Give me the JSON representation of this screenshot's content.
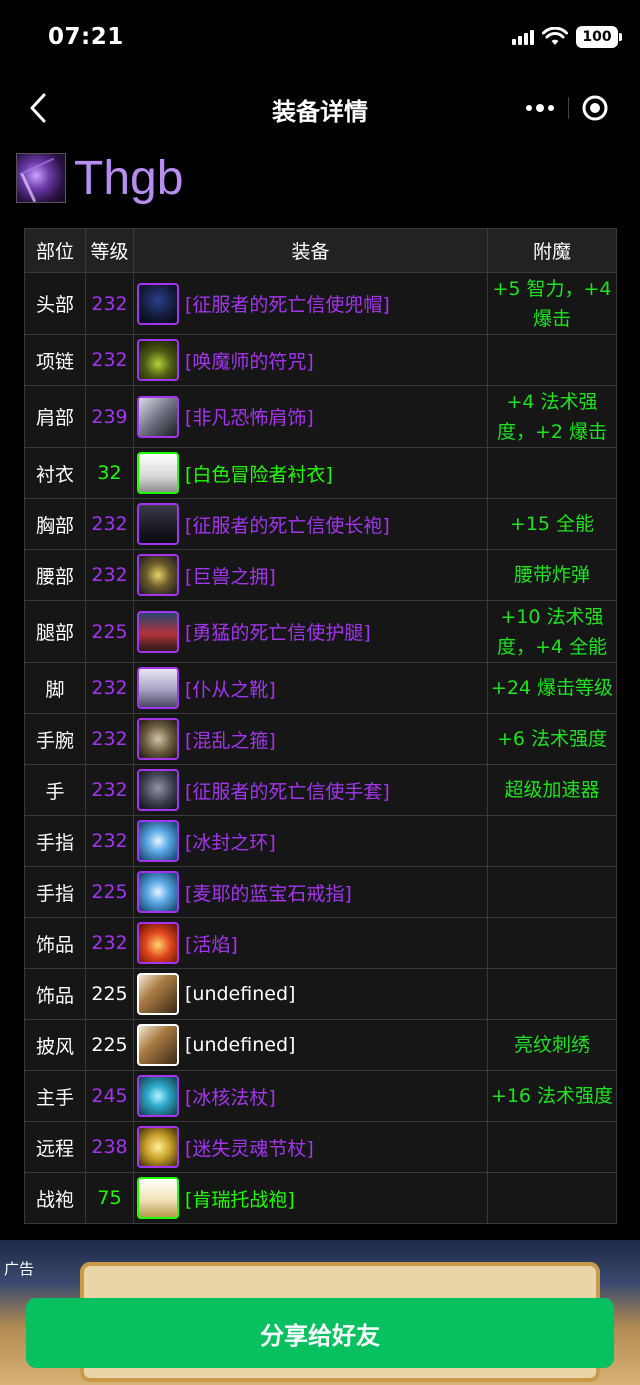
{
  "status": {
    "time": "07:21",
    "battery": "100"
  },
  "nav": {
    "title": "装备详情"
  },
  "character": {
    "name": "Thgb"
  },
  "table": {
    "headers": {
      "slot": "部位",
      "level": "等级",
      "item": "装备",
      "enchant": "附魔"
    },
    "rows": [
      {
        "slot": "头部",
        "level": "232",
        "item": "[征服者的死亡信使兜帽]",
        "enchant": "+5 智力，+4 爆击",
        "quality": "epic",
        "icon": "hood-icon"
      },
      {
        "slot": "项链",
        "level": "232",
        "item": "[唤魔师的符咒]",
        "enchant": "",
        "quality": "epic",
        "icon": "necklace-icon"
      },
      {
        "slot": "肩部",
        "level": "239",
        "item": "[非凡恐怖肩饰]",
        "enchant": "+4 法术强度，+2 爆击",
        "quality": "epic",
        "icon": "shoulder-icon"
      },
      {
        "slot": "衬衣",
        "level": "32",
        "item": "[白色冒险者衬衣]",
        "enchant": "",
        "quality": "uncommon",
        "icon": "shirt-icon"
      },
      {
        "slot": "胸部",
        "level": "232",
        "item": "[征服者的死亡信使长袍]",
        "enchant": "+15 全能",
        "quality": "epic",
        "icon": "robe-icon"
      },
      {
        "slot": "腰部",
        "level": "232",
        "item": "[巨兽之拥]",
        "enchant": "腰带炸弹",
        "quality": "epic",
        "icon": "belt-icon"
      },
      {
        "slot": "腿部",
        "level": "225",
        "item": "[勇猛的死亡信使护腿]",
        "enchant": "+10 法术强度，+4 全能",
        "quality": "epic",
        "icon": "legs-icon"
      },
      {
        "slot": "脚",
        "level": "232",
        "item": "[仆从之靴]",
        "enchant": "+24 爆击等级",
        "quality": "epic",
        "icon": "boots-icon"
      },
      {
        "slot": "手腕",
        "level": "232",
        "item": "[混乱之箍]",
        "enchant": "+6 法术强度",
        "quality": "epic",
        "icon": "bracer-icon"
      },
      {
        "slot": "手",
        "level": "232",
        "item": "[征服者的死亡信使手套]",
        "enchant": "超级加速器",
        "quality": "epic",
        "icon": "gloves-icon"
      },
      {
        "slot": "手指",
        "level": "232",
        "item": "[冰封之环]",
        "enchant": "",
        "quality": "epic",
        "icon": "ring-icon"
      },
      {
        "slot": "手指",
        "level": "225",
        "item": "[麦耶的蓝宝石戒指]",
        "enchant": "",
        "quality": "epic",
        "icon": "ring-icon"
      },
      {
        "slot": "饰品",
        "level": "232",
        "item": "[活焰]",
        "enchant": "",
        "quality": "epic",
        "icon": "flame-icon"
      },
      {
        "slot": "饰品",
        "level": "225",
        "item": "[undefined]",
        "enchant": "",
        "quality": "unknown",
        "icon": "unknown-item-icon"
      },
      {
        "slot": "披风",
        "level": "225",
        "item": "[undefined]",
        "enchant": "亮纹刺绣",
        "quality": "unknown",
        "icon": "unknown-item-icon"
      },
      {
        "slot": "主手",
        "level": "245",
        "item": "[冰核法杖]",
        "enchant": "+16 法术强度",
        "quality": "epic",
        "icon": "staff-icon"
      },
      {
        "slot": "远程",
        "level": "238",
        "item": "[迷失灵魂节杖]",
        "enchant": "",
        "quality": "epic",
        "icon": "wand-icon"
      },
      {
        "slot": "战袍",
        "level": "75",
        "item": "[肯瑞托战袍]",
        "enchant": "",
        "quality": "uncommon",
        "icon": "tabard-icon"
      }
    ]
  },
  "ad": {
    "label": "广告"
  },
  "share_button": {
    "label": "分享给好友"
  },
  "colors": {
    "epic": "#a335ee",
    "uncommon": "#1eff00",
    "unknown": "#ffffff",
    "enchant": "#1ee31e",
    "share": "#07c160"
  }
}
